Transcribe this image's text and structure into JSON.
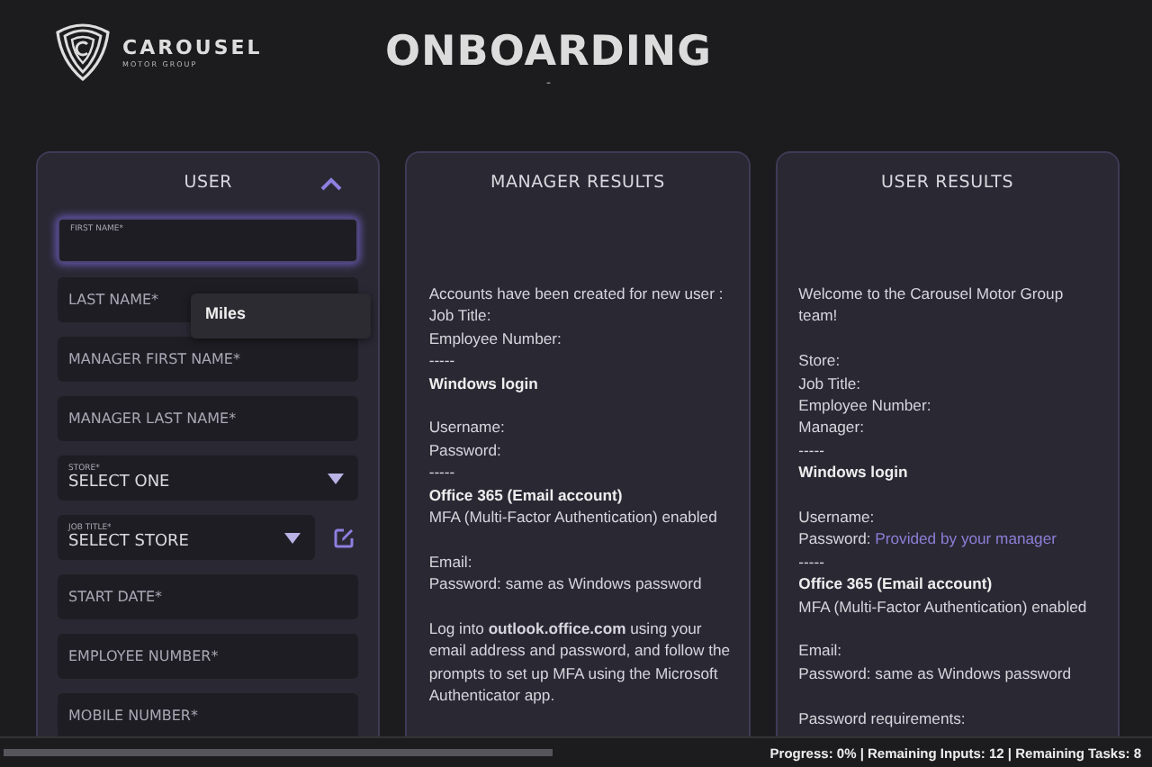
{
  "header": {
    "brand": "CAROUSEL",
    "brand_sub": "MOTOR GROUP",
    "title": "ONBOARDING",
    "subtitle": "-"
  },
  "user_panel": {
    "title": "USER",
    "expanded": true,
    "fields": [
      {
        "kind": "text",
        "label": "FIRST NAME*",
        "focused": true,
        "floating": true
      },
      {
        "kind": "text",
        "label": "LAST NAME*",
        "focused": false,
        "floating": false
      },
      {
        "kind": "text",
        "label": "MANAGER FIRST NAME*",
        "focused": false,
        "floating": false
      },
      {
        "kind": "text",
        "label": "MANAGER LAST NAME*",
        "focused": false,
        "floating": false
      },
      {
        "kind": "select",
        "label": "STORE*",
        "value": "SELECT ONE",
        "editable": false
      },
      {
        "kind": "select",
        "label": "JOB TITLE*",
        "value": "SELECT STORE",
        "editable": true
      },
      {
        "kind": "text",
        "label": "START DATE*",
        "focused": false,
        "floating": false
      },
      {
        "kind": "text",
        "label": "EMPLOYEE NUMBER*",
        "focused": false,
        "floating": false
      },
      {
        "kind": "text",
        "label": "MOBILE NUMBER*",
        "focused": false,
        "floating": false
      }
    ],
    "suggestion": "Miles"
  },
  "manager_results": {
    "title": "MANAGER RESULTS",
    "lines": [
      {
        "kind": "text",
        "text": "Accounts have been created for new user :"
      },
      {
        "kind": "text",
        "text": "Job Title:"
      },
      {
        "kind": "text",
        "text": "Employee Number:"
      },
      {
        "kind": "text",
        "text": "-----"
      },
      {
        "kind": "heading",
        "text": "Windows login"
      },
      {
        "kind": "blank"
      },
      {
        "kind": "text",
        "text": "Username:"
      },
      {
        "kind": "text",
        "text": "Password:"
      },
      {
        "kind": "text",
        "text": "-----"
      },
      {
        "kind": "heading",
        "text": "Office 365 (Email account)"
      },
      {
        "kind": "text",
        "text": "MFA (Multi-Factor Authentication) enabled"
      },
      {
        "kind": "blank"
      },
      {
        "kind": "text",
        "text": "Email:"
      },
      {
        "kind": "text",
        "text": "Password: same as Windows password"
      },
      {
        "kind": "blank"
      },
      {
        "kind": "text",
        "text": "Log into **outlook.office.com** using your email address and password, and follow the prompts to set up MFA using the Microsoft Authenticator app."
      }
    ]
  },
  "user_results": {
    "title": "USER RESULTS",
    "lines": [
      {
        "kind": "text",
        "text": "Welcome to the Carousel Motor Group team!"
      },
      {
        "kind": "blank"
      },
      {
        "kind": "text",
        "text": "Store:"
      },
      {
        "kind": "text",
        "text": "Job Title:"
      },
      {
        "kind": "text",
        "text": "Employee Number:"
      },
      {
        "kind": "text",
        "text": "Manager:"
      },
      {
        "kind": "text",
        "text": "-----"
      },
      {
        "kind": "heading",
        "text": "Windows login"
      },
      {
        "kind": "blank"
      },
      {
        "kind": "text",
        "text": "Username:"
      },
      {
        "kind": "link",
        "text": "Password:",
        "link": "Provided by your manager"
      },
      {
        "kind": "text",
        "text": "-----"
      },
      {
        "kind": "heading",
        "text": "Office 365 (Email account)"
      },
      {
        "kind": "text",
        "text": "MFA (Multi-Factor Authentication) enabled"
      },
      {
        "kind": "blank"
      },
      {
        "kind": "text",
        "text": "Email:"
      },
      {
        "kind": "text",
        "text": "Password: same as Windows password"
      },
      {
        "kind": "blank"
      },
      {
        "kind": "text",
        "text": "Password requirements:"
      }
    ]
  },
  "status_bar": {
    "progress": {
      "level": 0
    },
    "text": "Progress: 0% | Remaining Inputs: 12 | Remaining Tasks: 8"
  }
}
